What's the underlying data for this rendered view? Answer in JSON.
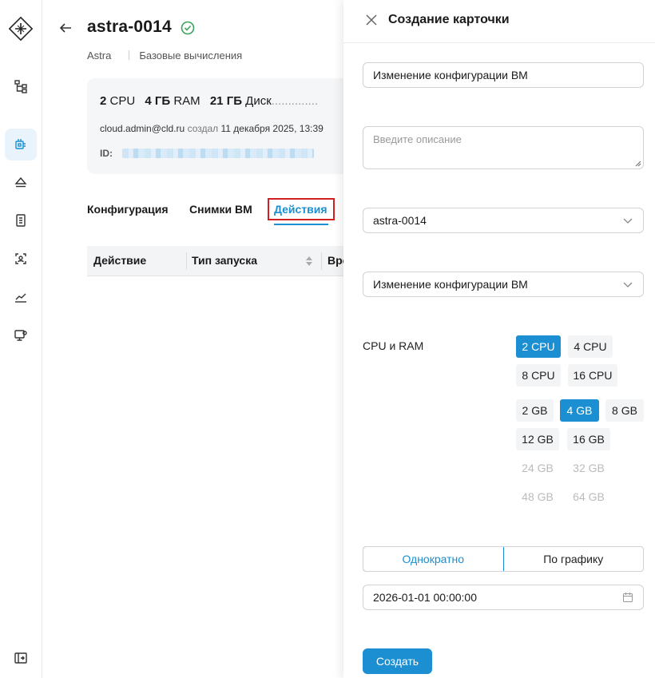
{
  "header": {
    "title": "astra-0014",
    "os": "Astra",
    "service": "Базовые вычисления"
  },
  "card": {
    "cpu_value": "2",
    "cpu_unit": "CPU",
    "ram_value": "4 ГБ",
    "ram_unit": "RAM",
    "disk_value": "21 ГБ",
    "disk_unit": "Диск",
    "creator_email": "cloud.admin@cld.ru",
    "created_label": "создал",
    "created_date": "11 декабря 2025, 13:39",
    "id_label": "ID:"
  },
  "tabs": [
    {
      "label": "Конфигурация"
    },
    {
      "label": "Снимки ВМ"
    },
    {
      "label": "Действия"
    }
  ],
  "table": {
    "columns": [
      "Действие",
      "Тип запуска",
      "Вре"
    ]
  },
  "panel": {
    "title": "Создание карточки",
    "name_value": "Изменение конфигурации ВМ",
    "description_placeholder": "Введите описание",
    "vm_select": "astra-0014",
    "action_select": "Изменение конфигурации ВМ",
    "cpu_ram_label": "CPU и RAM",
    "cpu_options": [
      {
        "label": "2 CPU",
        "state": "selected"
      },
      {
        "label": "4 CPU",
        "state": "normal"
      },
      {
        "label": "8 CPU",
        "state": "normal"
      },
      {
        "label": "16 CPU",
        "state": "normal"
      }
    ],
    "ram_options": [
      {
        "label": "2 GB",
        "state": "normal"
      },
      {
        "label": "4 GB",
        "state": "selected"
      },
      {
        "label": "8 GB",
        "state": "normal"
      },
      {
        "label": "12 GB",
        "state": "normal"
      },
      {
        "label": "16 GB",
        "state": "normal"
      },
      {
        "label": "24 GB",
        "state": "disabled"
      },
      {
        "label": "32 GB",
        "state": "disabled"
      },
      {
        "label": "48 GB",
        "state": "disabled"
      },
      {
        "label": "64 GB",
        "state": "disabled"
      }
    ],
    "schedule_once": "Однократно",
    "schedule_recurring": "По графику",
    "datetime_value": "2026-01-01 00:00:00",
    "create_label": "Создать"
  },
  "colors": {
    "accent": "#1b8fd1",
    "highlight_border": "#d21f1f"
  }
}
